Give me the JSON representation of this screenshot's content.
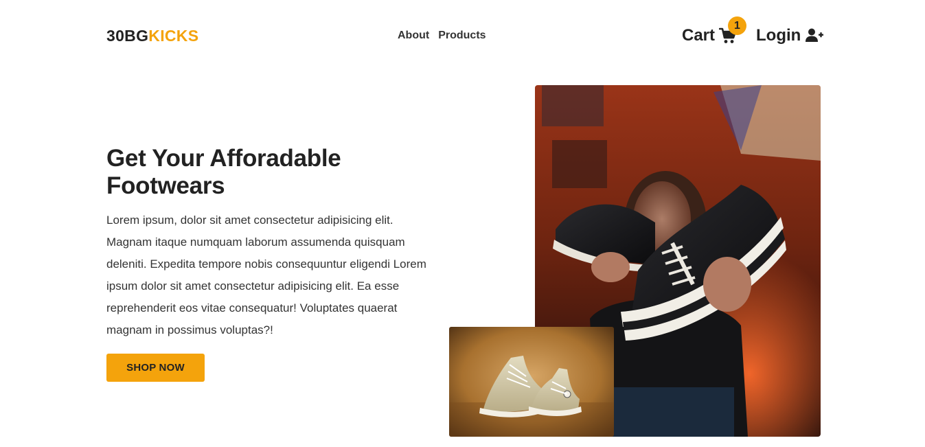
{
  "brand": {
    "part_a": "30BG",
    "part_b": "KICKS"
  },
  "nav": {
    "items": [
      "About",
      "Products"
    ]
  },
  "cart": {
    "label": "Cart",
    "count": "1"
  },
  "login": {
    "label": "Login"
  },
  "hero": {
    "title": "Get Your Afforadable Footwears",
    "body": "Lorem ipsum, dolor sit amet consectetur adipisicing elit. Magnam itaque numquam laborum assumenda quisquam deleniti. Expedita tempore nobis consequuntur eligendi Lorem ipsum dolor sit amet consectetur adipisicing elit. Ea esse reprehenderit eos vitae consequatur! Voluptates quaerat magnam in possimus voluptas?!",
    "button": "SHOP NOW"
  },
  "colors": {
    "accent": "#f4a30c",
    "text": "#222222"
  },
  "icons": {
    "cart": "shopping-cart-icon",
    "login": "user-plus-icon"
  }
}
